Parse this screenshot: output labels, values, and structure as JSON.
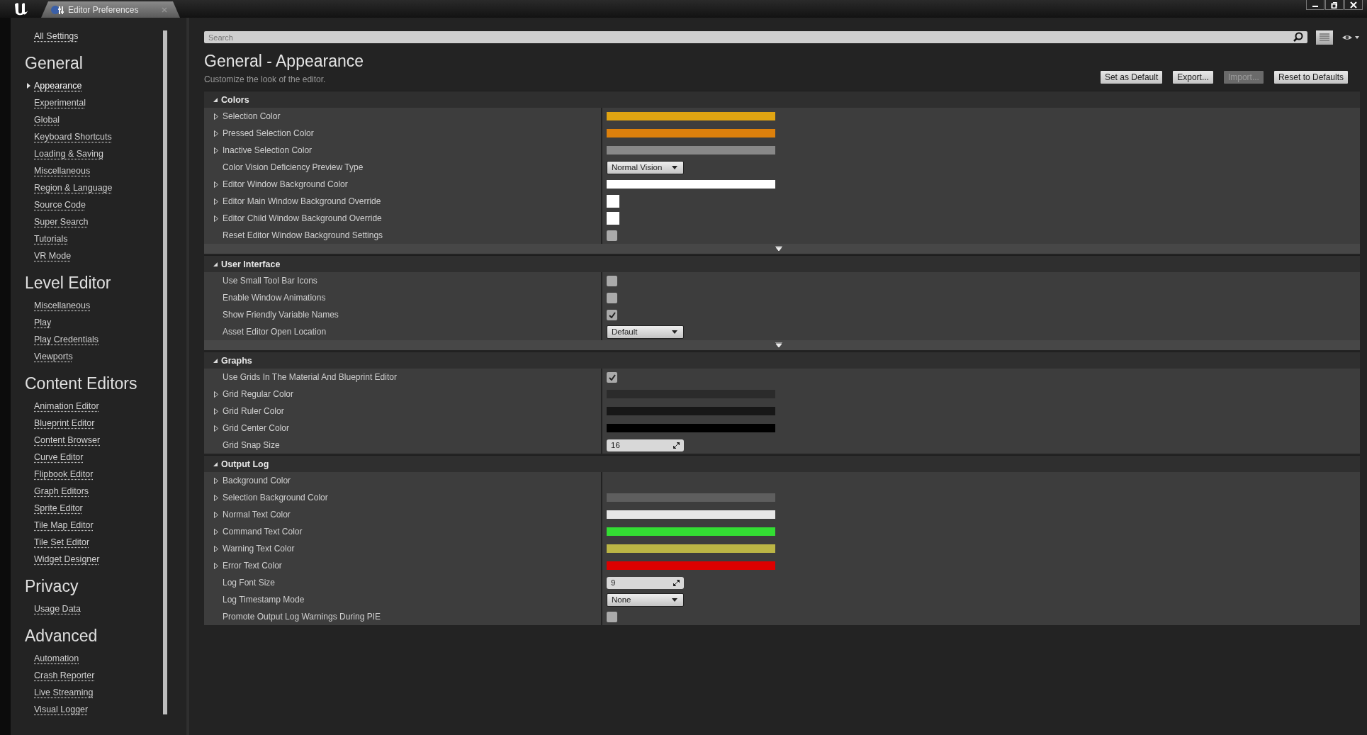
{
  "window": {
    "title": "Editor Preferences"
  },
  "sidebar": {
    "all_settings": "All Settings",
    "groups": [
      {
        "title": "General",
        "items": [
          {
            "label": "Appearance",
            "selected": true
          },
          {
            "label": "Experimental",
            "selected": false
          },
          {
            "label": "Global",
            "selected": false
          },
          {
            "label": "Keyboard Shortcuts",
            "selected": false
          },
          {
            "label": "Loading & Saving",
            "selected": false
          },
          {
            "label": "Miscellaneous",
            "selected": false
          },
          {
            "label": "Region & Language",
            "selected": false
          },
          {
            "label": "Source Code",
            "selected": false
          },
          {
            "label": "Super Search",
            "selected": false
          },
          {
            "label": "Tutorials",
            "selected": false
          },
          {
            "label": "VR Mode",
            "selected": false
          }
        ]
      },
      {
        "title": "Level Editor",
        "items": [
          {
            "label": "Miscellaneous",
            "selected": false
          },
          {
            "label": "Play",
            "selected": false
          },
          {
            "label": "Play Credentials",
            "selected": false
          },
          {
            "label": "Viewports",
            "selected": false
          }
        ]
      },
      {
        "title": "Content Editors",
        "items": [
          {
            "label": "Animation Editor",
            "selected": false
          },
          {
            "label": "Blueprint Editor",
            "selected": false
          },
          {
            "label": "Content Browser",
            "selected": false
          },
          {
            "label": "Curve Editor",
            "selected": false
          },
          {
            "label": "Flipbook Editor",
            "selected": false
          },
          {
            "label": "Graph Editors",
            "selected": false
          },
          {
            "label": "Sprite Editor",
            "selected": false
          },
          {
            "label": "Tile Map Editor",
            "selected": false
          },
          {
            "label": "Tile Set Editor",
            "selected": false
          },
          {
            "label": "Widget Designer",
            "selected": false
          }
        ]
      },
      {
        "title": "Privacy",
        "items": [
          {
            "label": "Usage Data",
            "selected": false
          }
        ]
      },
      {
        "title": "Advanced",
        "items": [
          {
            "label": "Automation",
            "selected": false
          },
          {
            "label": "Crash Reporter",
            "selected": false
          },
          {
            "label": "Live Streaming",
            "selected": false
          },
          {
            "label": "Visual Logger",
            "selected": false
          }
        ]
      }
    ]
  },
  "search": {
    "placeholder": "Search"
  },
  "header": {
    "title": "General - Appearance",
    "description": "Customize the look of the editor."
  },
  "buttons": [
    {
      "label": "Set as Default",
      "disabled": false
    },
    {
      "label": "Export...",
      "disabled": false
    },
    {
      "label": "Import...",
      "disabled": true
    },
    {
      "label": "Reset to Defaults",
      "disabled": false
    }
  ],
  "sections": [
    {
      "title": "Colors",
      "expanded": true,
      "advanced_toggle": true,
      "rows": [
        {
          "label": "Selection Color",
          "expandable": true,
          "kind": "color",
          "color": "#e0a412"
        },
        {
          "label": "Pressed Selection Color",
          "expandable": true,
          "kind": "color",
          "color": "#dc800c"
        },
        {
          "label": "Inactive Selection Color",
          "expandable": true,
          "kind": "color",
          "color": "#888888"
        },
        {
          "label": "Color Vision Deficiency Preview Type",
          "expandable": false,
          "kind": "dropdown",
          "value": "Normal Vision"
        },
        {
          "label": "Editor Window Background Color",
          "expandable": true,
          "kind": "color",
          "color": "#ffffff"
        },
        {
          "label": "Editor Main Window Background Override",
          "expandable": true,
          "kind": "swatch",
          "color": "#ffffff"
        },
        {
          "label": "Editor Child Window Background Override",
          "expandable": true,
          "kind": "swatch",
          "color": "#ffffff"
        },
        {
          "label": "Reset Editor Window Background Settings",
          "expandable": false,
          "kind": "checkbox",
          "checked": false
        }
      ]
    },
    {
      "title": "User Interface",
      "expanded": true,
      "advanced_toggle": true,
      "rows": [
        {
          "label": "Use Small Tool Bar Icons",
          "expandable": false,
          "kind": "checkbox",
          "checked": false
        },
        {
          "label": "Enable Window Animations",
          "expandable": false,
          "kind": "checkbox",
          "checked": false
        },
        {
          "label": "Show Friendly Variable Names",
          "expandable": false,
          "kind": "checkbox",
          "checked": true
        },
        {
          "label": "Asset Editor Open Location",
          "expandable": false,
          "kind": "dropdown",
          "value": "Default"
        }
      ]
    },
    {
      "title": "Graphs",
      "expanded": true,
      "advanced_toggle": false,
      "rows": [
        {
          "label": "Use Grids In The Material And Blueprint Editor",
          "expandable": false,
          "kind": "checkbox",
          "checked": true
        },
        {
          "label": "Grid Regular Color",
          "expandable": true,
          "kind": "color",
          "color": "#2b2b2b"
        },
        {
          "label": "Grid Ruler Color",
          "expandable": true,
          "kind": "color",
          "color": "#171717"
        },
        {
          "label": "Grid Center Color",
          "expandable": true,
          "kind": "color",
          "color": "#000000"
        },
        {
          "label": "Grid Snap Size",
          "expandable": false,
          "kind": "number",
          "value": "16"
        }
      ]
    },
    {
      "title": "Output Log",
      "expanded": true,
      "advanced_toggle": false,
      "rows": [
        {
          "label": "Background Color",
          "expandable": true,
          "kind": "color"
        },
        {
          "label": "Selection Background Color",
          "expandable": true,
          "kind": "color",
          "color": "#5e5e5e"
        },
        {
          "label": "Normal Text Color",
          "expandable": true,
          "kind": "color",
          "color": "#e6e6e6"
        },
        {
          "label": "Command Text Color",
          "expandable": true,
          "kind": "color",
          "color": "#33dd33"
        },
        {
          "label": "Warning Text Color",
          "expandable": true,
          "kind": "color",
          "color": "#bbb545"
        },
        {
          "label": "Error Text Color",
          "expandable": true,
          "kind": "color",
          "color": "#dd0000"
        },
        {
          "label": "Log Font Size",
          "expandable": false,
          "kind": "number",
          "value": "9"
        },
        {
          "label": "Log Timestamp Mode",
          "expandable": false,
          "kind": "dropdown",
          "value": "None"
        },
        {
          "label": "Promote Output Log Warnings During PIE",
          "expandable": false,
          "kind": "checkbox",
          "checked": false
        }
      ]
    }
  ]
}
